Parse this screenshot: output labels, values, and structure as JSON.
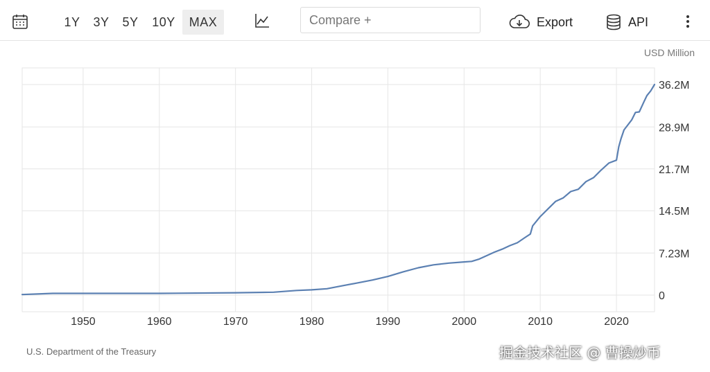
{
  "toolbar": {
    "ranges": [
      {
        "label": "1Y",
        "active": false
      },
      {
        "label": "3Y",
        "active": false
      },
      {
        "label": "5Y",
        "active": false
      },
      {
        "label": "10Y",
        "active": false
      },
      {
        "label": "MAX",
        "active": true
      }
    ],
    "compare_placeholder": "Compare +",
    "export_label": "Export",
    "api_label": "API",
    "icons": {
      "calendar": "calendar-icon",
      "chart_type": "line-chart-icon",
      "export": "cloud-download-icon",
      "api": "database-icon",
      "more": "more-vertical-icon"
    }
  },
  "unit_label": "USD Million",
  "source": "U.S. Department of the Treasury",
  "watermark": "掘金技术社区 @ 曹操炒币",
  "colors": {
    "line": "#5b80b2",
    "grid": "#e6e6e6",
    "active_range_bg": "#eeeeee"
  },
  "chart_data": {
    "type": "line",
    "title": "",
    "xlabel": "",
    "ylabel": "USD Million",
    "xlim": [
      1942,
      2025
    ],
    "ylim": [
      0,
      36.2
    ],
    "x_ticks": [
      1950,
      1960,
      1970,
      1980,
      1990,
      2000,
      2010,
      2020
    ],
    "y_ticks": [
      {
        "value": 0,
        "label": "0"
      },
      {
        "value": 7.23,
        "label": "7.23M"
      },
      {
        "value": 14.5,
        "label": "14.5M"
      },
      {
        "value": 21.7,
        "label": "21.7M"
      },
      {
        "value": 28.9,
        "label": "28.9M"
      },
      {
        "value": 36.2,
        "label": "36.2M"
      }
    ],
    "grid": true,
    "series": [
      {
        "x": [
          1942,
          1946,
          1950,
          1960,
          1970,
          1975,
          1978,
          1980,
          1982,
          1984,
          1986,
          1988,
          1990,
          1992,
          1994,
          1996,
          1998,
          2000,
          2001,
          2002,
          2003,
          2004,
          2005,
          2006,
          2007,
          2008,
          2008.7,
          2009,
          2010,
          2011,
          2012,
          2013,
          2014,
          2015,
          2016,
          2017,
          2018,
          2019,
          2020,
          2020.3,
          2020.6,
          2021,
          2022,
          2022.5,
          2023,
          2023.6,
          2024,
          2024.5,
          2025
        ],
        "y": [
          0.1,
          0.3,
          0.3,
          0.3,
          0.4,
          0.5,
          0.8,
          0.9,
          1.1,
          1.6,
          2.1,
          2.6,
          3.2,
          4.0,
          4.7,
          5.2,
          5.5,
          5.7,
          5.8,
          6.2,
          6.8,
          7.4,
          7.9,
          8.5,
          9.0,
          9.9,
          10.5,
          11.9,
          13.5,
          14.8,
          16.1,
          16.7,
          17.8,
          18.2,
          19.5,
          20.2,
          21.5,
          22.7,
          23.2,
          25.5,
          26.9,
          28.4,
          30.1,
          31.4,
          31.5,
          33.2,
          34.3,
          35.1,
          36.2
        ]
      }
    ]
  }
}
